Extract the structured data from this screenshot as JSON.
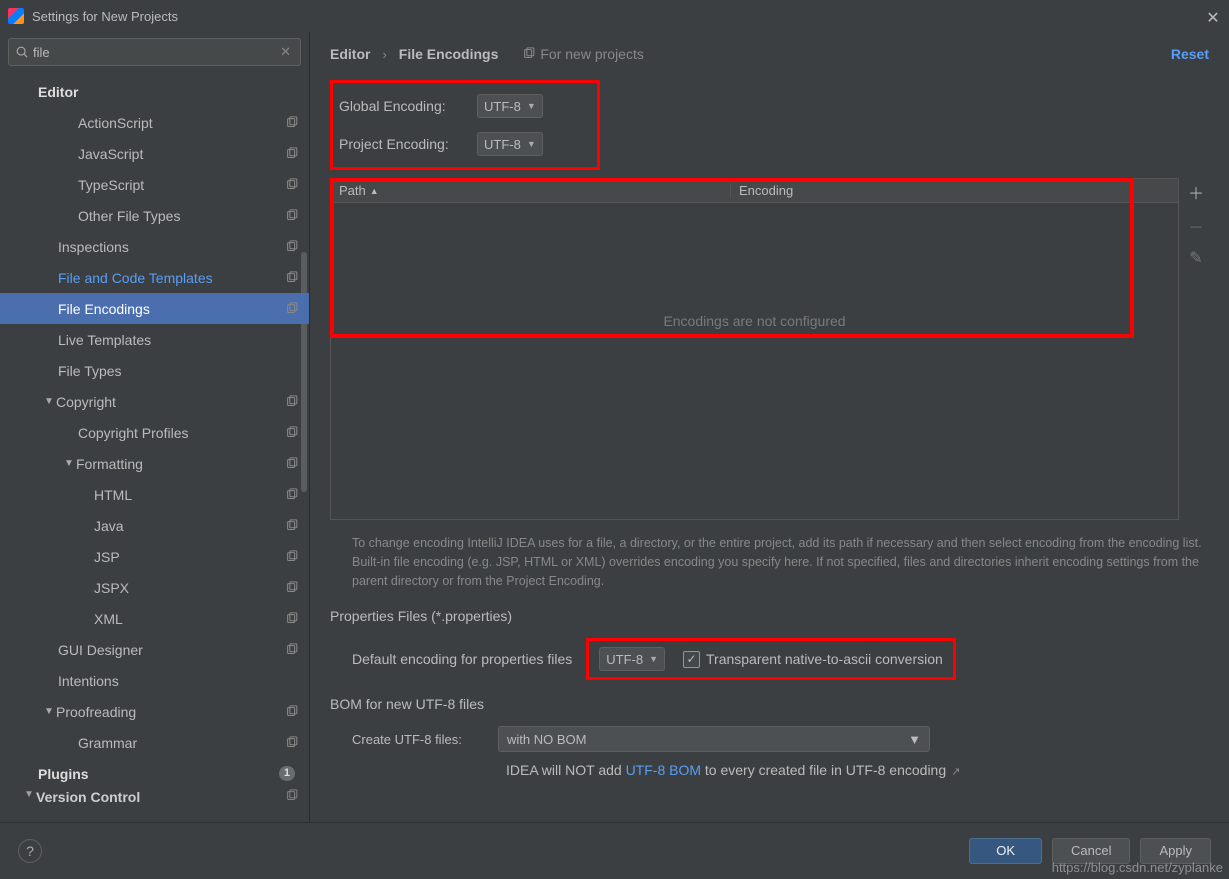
{
  "window": {
    "title": "Settings for New Projects"
  },
  "search": {
    "value": "file"
  },
  "tree": {
    "items": [
      {
        "label": "Editor",
        "pad": "pad1",
        "bold": true,
        "arrow": "",
        "copy": false
      },
      {
        "label": "ActionScript",
        "pad": "pad3",
        "copy": true
      },
      {
        "label": "JavaScript",
        "pad": "pad3",
        "copy": true
      },
      {
        "label": "TypeScript",
        "pad": "pad3",
        "copy": true
      },
      {
        "label": "Other File Types",
        "pad": "pad3",
        "copy": true
      },
      {
        "label": "Inspections",
        "pad": "pad2",
        "copy": true
      },
      {
        "label": "File and Code Templates",
        "pad": "pad2",
        "copy": true,
        "highlight": true
      },
      {
        "label": "File Encodings",
        "pad": "pad2",
        "copy": true,
        "selected": true
      },
      {
        "label": "Live Templates",
        "pad": "pad2"
      },
      {
        "label": "File Types",
        "pad": "pad2"
      },
      {
        "label": "Copyright",
        "pad": "pad2",
        "arrow": "▼",
        "copy": true
      },
      {
        "label": "Copyright Profiles",
        "pad": "pad3",
        "copy": true
      },
      {
        "label": "Formatting",
        "pad": "pad3",
        "arrow": "▼",
        "copy": true
      },
      {
        "label": "HTML",
        "pad": "pad4",
        "copy": true
      },
      {
        "label": "Java",
        "pad": "pad4",
        "copy": true
      },
      {
        "label": "JSP",
        "pad": "pad4",
        "copy": true
      },
      {
        "label": "JSPX",
        "pad": "pad4",
        "copy": true
      },
      {
        "label": "XML",
        "pad": "pad4",
        "copy": true
      },
      {
        "label": "GUI Designer",
        "pad": "pad2",
        "copy": true
      },
      {
        "label": "Intentions",
        "pad": "pad2"
      },
      {
        "label": "Proofreading",
        "pad": "pad2",
        "arrow": "▼",
        "copy": true
      },
      {
        "label": "Grammar",
        "pad": "pad3",
        "copy": true
      },
      {
        "label": "Plugins",
        "pad": "pad1",
        "bold": true,
        "count": "1"
      },
      {
        "label": "Version Control",
        "pad": "pad1",
        "bold": true,
        "arrow": "▼",
        "copy": true,
        "cut": true
      }
    ]
  },
  "breadcrumb": {
    "a": "Editor",
    "b": "File Encodings",
    "for": "For new projects",
    "reset": "Reset"
  },
  "enc": {
    "globalLabel": "Global Encoding:",
    "globalVal": "UTF-8",
    "projectLabel": "Project Encoding:",
    "projectVal": "UTF-8"
  },
  "table": {
    "col1": "Path",
    "col2": "Encoding",
    "empty": "Encodings are not configured"
  },
  "desc": "To change encoding IntelliJ IDEA uses for a file, a directory, or the entire project, add its path if necessary and then select encoding from the encoding list. Built-in file encoding (e.g. JSP, HTML or XML) overrides encoding you specify here. If not specified, files and directories inherit encoding settings from the parent directory or from the Project Encoding.",
  "props": {
    "heading": "Properties Files (*.properties)",
    "label": "Default encoding for properties files",
    "val": "UTF-8",
    "chkLabel": "Transparent native-to-ascii conversion"
  },
  "bom": {
    "heading": "BOM for new UTF-8 files",
    "label": "Create UTF-8 files:",
    "val": "with NO BOM",
    "note1": "IDEA will NOT add ",
    "link": "UTF-8 BOM",
    "note2": " to every created file in UTF-8 encoding"
  },
  "footer": {
    "ok": "OK",
    "cancel": "Cancel",
    "apply": "Apply"
  },
  "watermark": "https://blog.csdn.net/zyplanke"
}
